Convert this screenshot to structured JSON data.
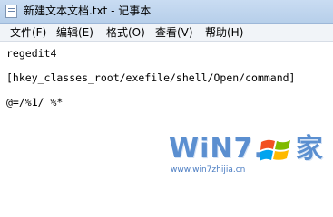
{
  "window": {
    "title": "新建文本文档.txt - 记事本"
  },
  "menu": {
    "items": [
      {
        "label": "文件(F)"
      },
      {
        "label": "编辑(E)"
      },
      {
        "label": "格式(O)"
      },
      {
        "label": "查看(V)"
      },
      {
        "label": "帮助(H)"
      }
    ]
  },
  "editor": {
    "lines": [
      "regedit4",
      "[hkey_classes_root/exefile/shell/Open/command]",
      "@=/%1/ %*"
    ]
  },
  "watermark": {
    "brand_text": "WiN7.",
    "brand_suffix": "家",
    "url": "www.win7zhijia.cn"
  },
  "colors": {
    "title_bar": "#c9dcf2",
    "menu_bar": "#f1f4f8",
    "watermark_blue": "#5b8fd0"
  },
  "icons": {
    "title": "notepad-icon",
    "watermark_flag": "windows-flag-icon"
  }
}
